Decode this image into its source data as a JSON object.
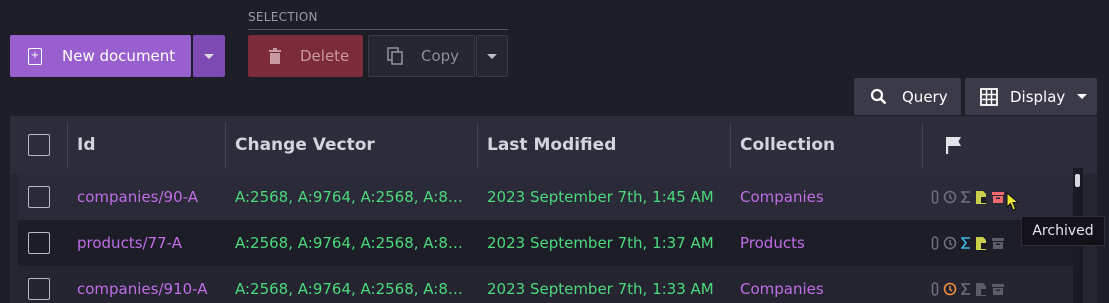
{
  "toolbar": {
    "new_document_label": "New document",
    "selection_label": "SELECTION",
    "delete_label": "Delete",
    "copy_label": "Copy",
    "query_label": "Query",
    "display_label": "Display"
  },
  "grid": {
    "columns": [
      "Id",
      "Change Vector",
      "Last Modified",
      "Collection"
    ],
    "rows": [
      {
        "id": "companies/90-A",
        "change_vector": "A:2568, A:9764, A:2568, A:88…",
        "last_modified": "2023 September 7th, 1:45 AM",
        "collection": "Companies"
      },
      {
        "id": "products/77-A",
        "change_vector": "A:2568, A:9764, A:2568, A:88…",
        "last_modified": "2023 September 7th, 1:37 AM",
        "collection": "Products"
      },
      {
        "id": "companies/910-A",
        "change_vector": "A:2568, A:9764, A:2568, A:88…",
        "last_modified": "2023 September 7th, 1:33 AM",
        "collection": "Companies"
      }
    ]
  },
  "tooltip": {
    "text": "Archived"
  },
  "colors": {
    "accent": "#9a5fcf",
    "link": "#c06de6",
    "green": "#4cd97c",
    "danger": "#7b2b3a"
  }
}
